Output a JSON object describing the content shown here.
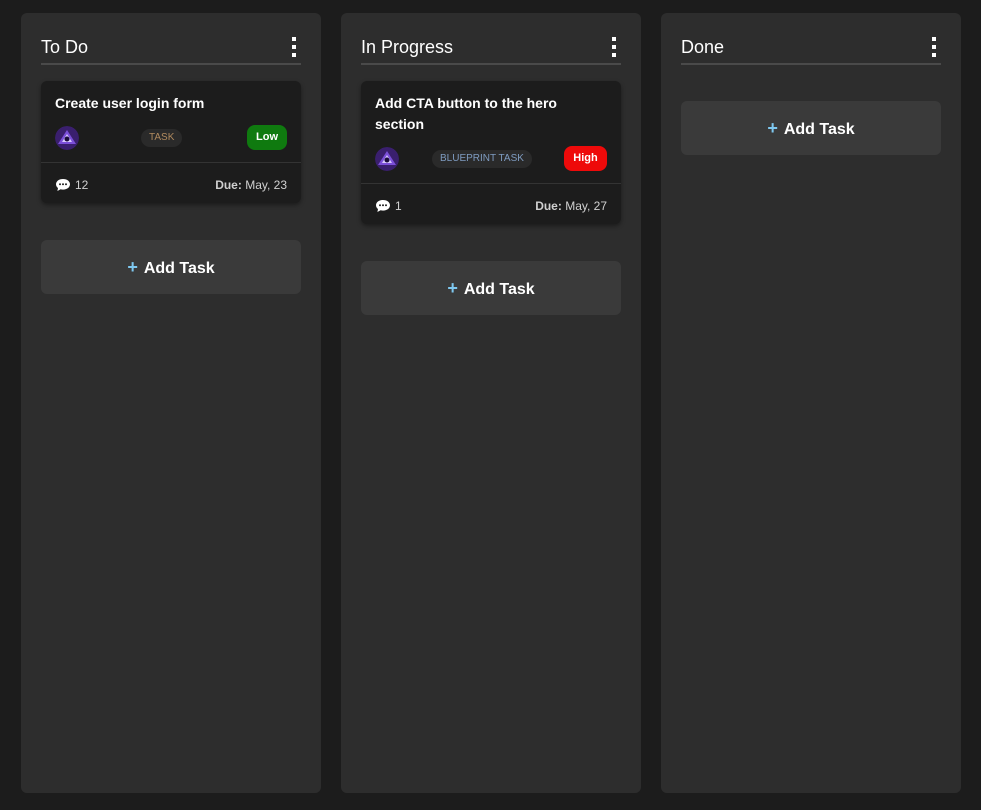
{
  "columns": [
    {
      "title": "To Do",
      "add_label": "Add Task",
      "cards": [
        {
          "title": "Create user login form",
          "type_badge": "TASK",
          "priority": "Low",
          "comments": "12",
          "due_label": "Due:",
          "due_date": "May, 23"
        }
      ]
    },
    {
      "title": "In Progress",
      "add_label": "Add Task",
      "cards": [
        {
          "title": "Add CTA button to the hero section",
          "type_badge": "BLUEPRINT TASK",
          "priority": "High",
          "comments": "1",
          "due_label": "Due:",
          "due_date": "May, 27"
        }
      ]
    },
    {
      "title": "Done",
      "add_label": "Add Task",
      "cards": []
    }
  ],
  "colors": {
    "background": "#1c1c1c",
    "column": "#2d2d2d",
    "card": "#1c1c1c",
    "add_button": "#3a3a3a",
    "plus_accent": "#7ec8f0",
    "priority_low": "#0f7a0f",
    "priority_high": "#ee0a0a",
    "task_badge_text": "#b08a5e",
    "blueprint_badge_text": "#7e9bc0"
  },
  "icons": {
    "column_menu": "vertical-ellipsis-icon",
    "comments": "comment-bubble-icon",
    "add": "plus-icon"
  }
}
